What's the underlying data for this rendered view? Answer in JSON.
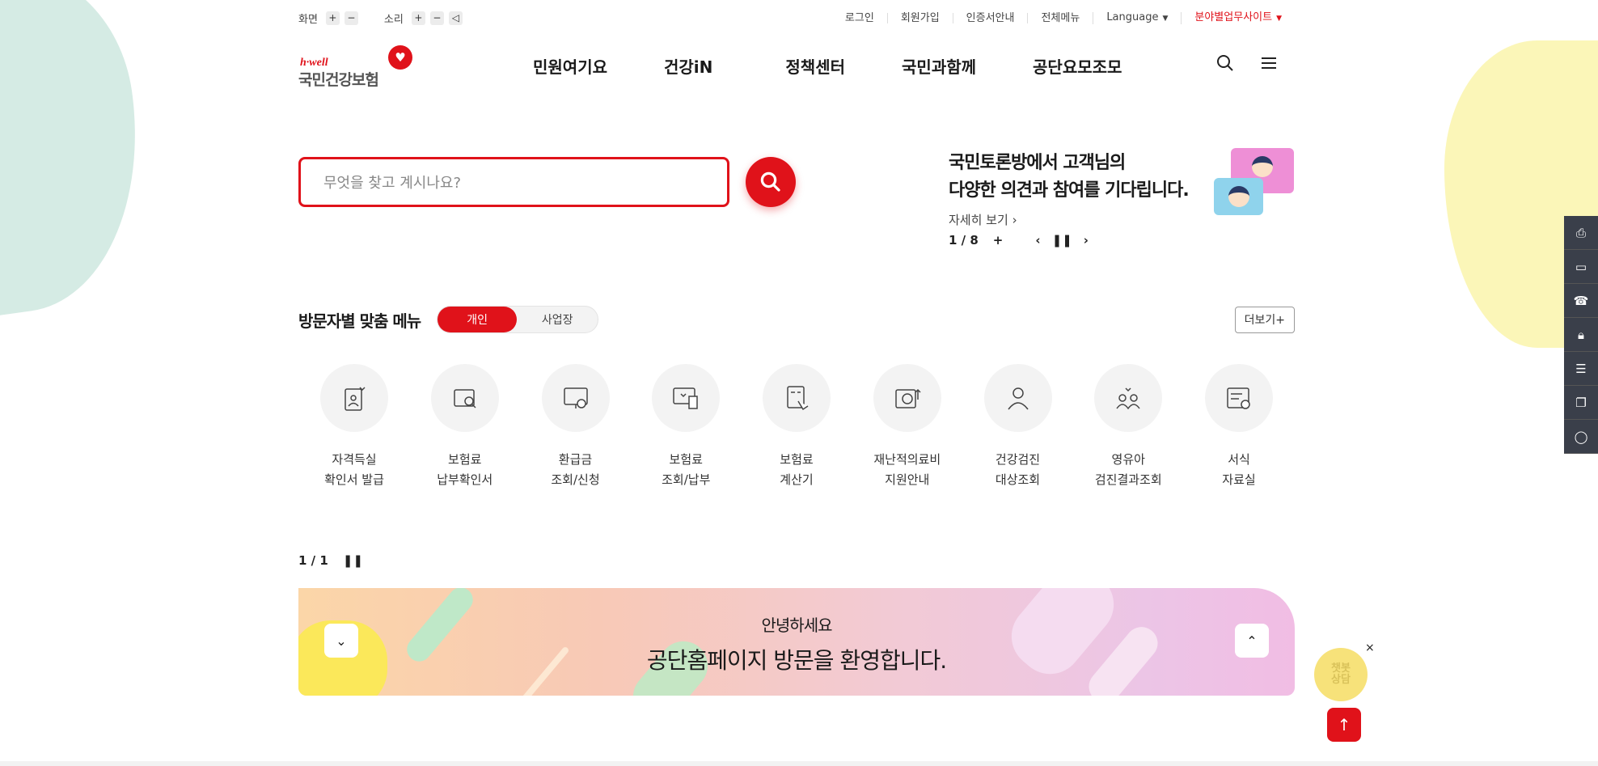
{
  "utility": {
    "screen_label": "화면",
    "sound_label": "소리",
    "plus": "+",
    "minus": "−",
    "links": [
      "로그인",
      "회원가입",
      "인증서안내",
      "전체메뉴",
      "Language",
      "분야별업무사이트"
    ]
  },
  "logo": {
    "tagline": "h·well",
    "name": "국민건강보험"
  },
  "nav": {
    "items": [
      "민원여기요",
      "건강iN",
      "정책센터",
      "국민과함께",
      "공단요모조모"
    ]
  },
  "search": {
    "placeholder": "무엇을 찾고 계시나요?"
  },
  "banner": {
    "line1": "국민토론방에서 고객님의",
    "line2": "다양한 의견과 참여를 기다립니다.",
    "more": "자세히 보기",
    "pager": "1 / 8"
  },
  "visitor_menu": {
    "title": "방문자별 맞춤 메뉴",
    "tab_personal": "개인",
    "tab_business": "사업장",
    "more": "더보기+",
    "items": [
      {
        "label": "자격득실\n확인서 발급",
        "icon": "id-card-heart-icon"
      },
      {
        "label": "보험료\n납부확인서",
        "icon": "document-search-icon"
      },
      {
        "label": "환급금\n조회/신청",
        "icon": "monitor-won-icon"
      },
      {
        "label": "보험료\n조회/납부",
        "icon": "monitor-heart-receipt-icon"
      },
      {
        "label": "보험료\n계산기",
        "icon": "calculator-hand-icon"
      },
      {
        "label": "재난적의료비\n지원안내",
        "icon": "wallet-won-icon"
      },
      {
        "label": "건강검진\n대상조회",
        "icon": "person-search-icon"
      },
      {
        "label": "영유아\n검진결과조회",
        "icon": "parent-child-heart-icon"
      },
      {
        "label": "서식\n자료실",
        "icon": "form-check-icon"
      }
    ]
  },
  "popup": {
    "pager": "1 / 1",
    "greeting": "안녕하세요",
    "message": "공단홈페이지 방문을 환영합니다."
  },
  "chatbot": {
    "label": "챗봇\n상담",
    "close": "×"
  },
  "colors": {
    "brand_red": "#e0121a",
    "sidebar": "#3a3f4a"
  }
}
